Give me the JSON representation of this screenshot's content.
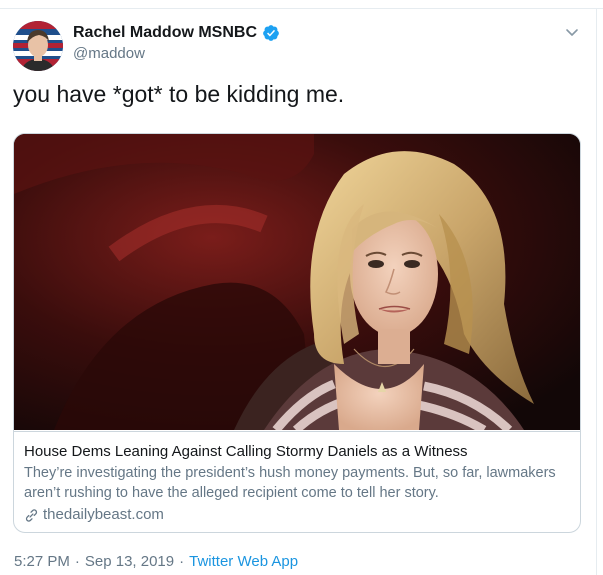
{
  "author": {
    "display_name": "Rachel Maddow MSNBC",
    "handle": "@maddow",
    "verified": true,
    "avatar_icon": "profile-photo"
  },
  "tweet": {
    "text": "you have *got* to be kidding me."
  },
  "card": {
    "title": "House Dems Leaning Against Calling Stormy Daniels as a Witness",
    "description": "They’re investigating the president’s hush money payments. But, so far, lawmakers aren’t rushing to have the alleged recipient come to tell her story.",
    "domain": "thedailybeast.com",
    "image_icon": "article-photo"
  },
  "meta": {
    "time": "5:27 PM",
    "separator": "·",
    "date": "Sep 13, 2019",
    "separator2": "·",
    "source": "Twitter Web App"
  },
  "colors": {
    "verified_blue": "#1da1f2",
    "link_blue": "#1b95e0",
    "secondary_text": "#657786",
    "border": "#ccd6dd"
  },
  "icons": {
    "menu": "chevron-down-icon",
    "verified": "verified-badge-icon",
    "link": "link-icon"
  }
}
